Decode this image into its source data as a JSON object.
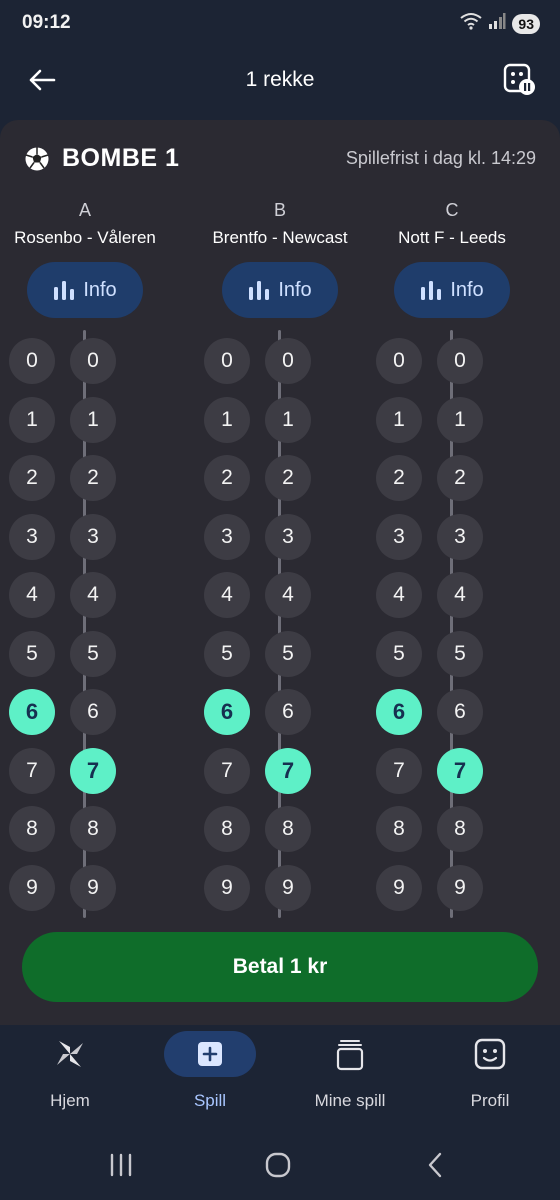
{
  "status_bar": {
    "time": "09:12",
    "battery": "93"
  },
  "header": {
    "title": "1 rekke"
  },
  "game": {
    "name": "BOMBE 1",
    "deadline": "Spillefrist i dag kl. 14:29"
  },
  "matches": [
    {
      "letter": "A",
      "name": "Rosenbo - Våleren",
      "info_label": "Info",
      "home_selected": 6,
      "away_selected": 7
    },
    {
      "letter": "B",
      "name": "Brentfo - Newcast",
      "info_label": "Info",
      "home_selected": 6,
      "away_selected": 7
    },
    {
      "letter": "C",
      "name": "Nott F - Leeds",
      "info_label": "Info",
      "home_selected": 6,
      "away_selected": 7
    }
  ],
  "score_options": [
    "0",
    "1",
    "2",
    "3",
    "4",
    "5",
    "6",
    "7",
    "8",
    "9"
  ],
  "pay_button": {
    "label": "Betal 1 kr"
  },
  "bottom_nav": [
    {
      "label": "Hjem",
      "icon": "home-pinwheel-icon",
      "active": false
    },
    {
      "label": "Spill",
      "icon": "plus-square-icon",
      "active": true
    },
    {
      "label": "Mine spill",
      "icon": "stacked-cards-icon",
      "active": false
    },
    {
      "label": "Profil",
      "icon": "smiley-face-icon",
      "active": false
    }
  ],
  "colors": {
    "background": "#1c2434",
    "card": "#2b2a32",
    "selected": "#5ef0c7",
    "info_button": "#1f3d6b",
    "pay_button": "#0f6d2a"
  }
}
